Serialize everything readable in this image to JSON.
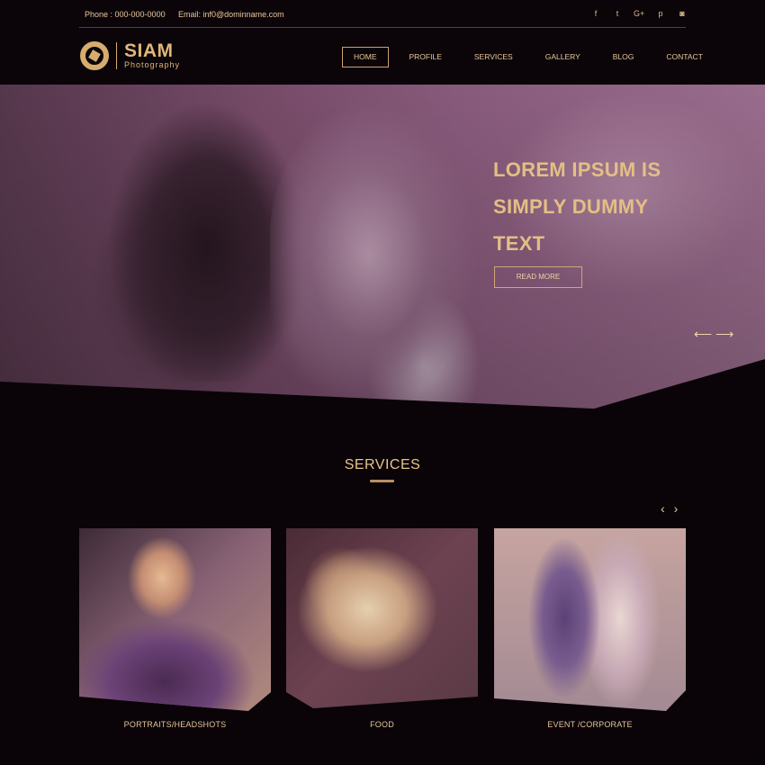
{
  "topbar": {
    "phone": "Phone : 000-000-0000",
    "email": "Email: inf0@dominname.com",
    "social": [
      {
        "icon": "facebook-icon",
        "glyph": "f"
      },
      {
        "icon": "twitter-icon",
        "glyph": "t"
      },
      {
        "icon": "google-plus-icon",
        "glyph": "G+"
      },
      {
        "icon": "pinterest-icon",
        "glyph": "p"
      },
      {
        "icon": "instagram-icon",
        "glyph": "◙"
      }
    ]
  },
  "brand": {
    "name": "SIAM",
    "sub": "Photography"
  },
  "nav": {
    "items": [
      {
        "label": "HOME",
        "active": true
      },
      {
        "label": "PROFILE",
        "active": false
      },
      {
        "label": "SERVICES",
        "active": false
      },
      {
        "label": "GALLERY",
        "active": false
      },
      {
        "label": "BLOG",
        "active": false
      },
      {
        "label": "CONTACT",
        "active": false
      }
    ]
  },
  "hero": {
    "title_lines": [
      "LOREM IPSUM IS",
      "SIMPLY DUMMY",
      "TEXT"
    ],
    "button": "READ MORE",
    "prev_arrow": "⟵",
    "next_arrow": "⟶"
  },
  "services": {
    "title": "SERVICES",
    "prev_arrow": "‹",
    "next_arrow": "›",
    "cards": [
      {
        "label": "PORTRAITS/HEADSHOTS"
      },
      {
        "label": "FOOD"
      },
      {
        "label": "EVENT /CORPORATE"
      }
    ]
  },
  "colors": {
    "accent": "#dfb77a",
    "background": "#0a0408",
    "hero_tint": "#8f5f82"
  }
}
